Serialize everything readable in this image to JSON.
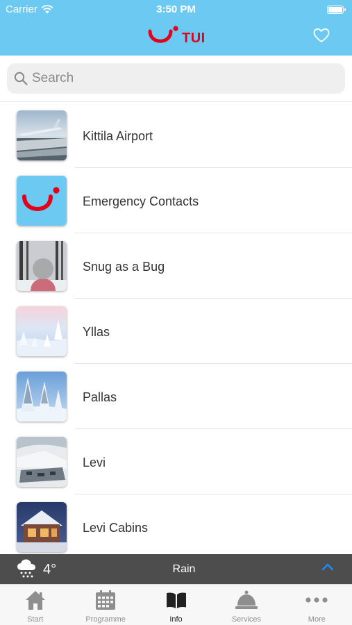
{
  "status_bar": {
    "carrier": "Carrier",
    "time": "3:50 PM"
  },
  "header": {
    "brand": "TUI"
  },
  "search": {
    "placeholder": "Search"
  },
  "items": [
    {
      "label": "Kittila Airport",
      "thumb": "airplane-wing-photo"
    },
    {
      "label": "Emergency Contacts",
      "thumb": "tui-logo"
    },
    {
      "label": "Snug as a Bug",
      "thumb": "wool-hat-photo"
    },
    {
      "label": "Yllas",
      "thumb": "snowy-trees-photo"
    },
    {
      "label": "Pallas",
      "thumb": "snowy-forest-photo"
    },
    {
      "label": "Levi",
      "thumb": "ski-resort-photo"
    },
    {
      "label": "Levi Cabins",
      "thumb": "cabin-photo"
    }
  ],
  "weather": {
    "temperature": "4°",
    "condition": "Rain",
    "icon": "cloud-rain-icon"
  },
  "tabs": [
    {
      "label": "Start",
      "icon": "home-icon",
      "active": false
    },
    {
      "label": "Programme",
      "icon": "calendar-icon",
      "active": false
    },
    {
      "label": "Info",
      "icon": "book-icon",
      "active": true
    },
    {
      "label": "Services",
      "icon": "service-bell-icon",
      "active": false
    },
    {
      "label": "More",
      "icon": "more-dots-icon",
      "active": false
    }
  ],
  "colors": {
    "header_bg": "#6ccaf2",
    "brand_red": "#e2001a",
    "weather_bg": "#4d4d4d",
    "accent_blue": "#1a8cff"
  }
}
